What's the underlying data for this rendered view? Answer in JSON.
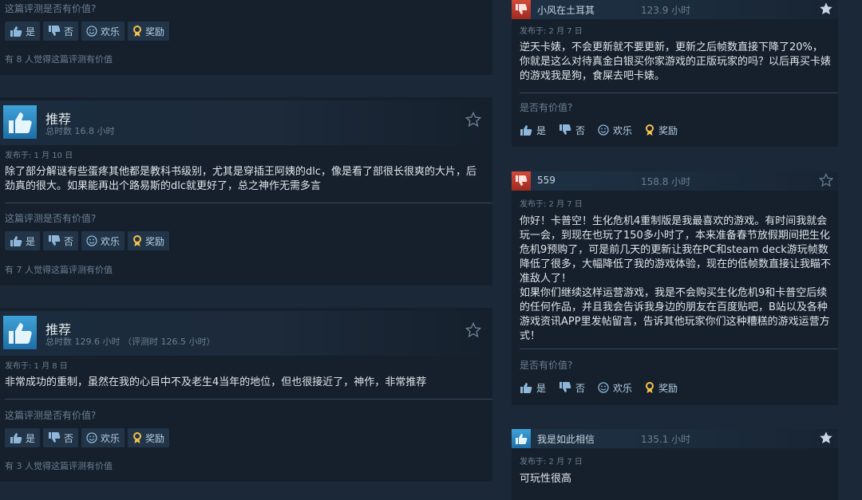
{
  "left_reviews": [
    {
      "partial": true,
      "helpful_question": "这篇评测是否有价值?",
      "found_helpful": "有 8 人觉得这篇评测有价值"
    },
    {
      "verdict": "推荐",
      "hours": "总时数 16.8 小时",
      "posted": "发布于: 1 月 10 日",
      "text": "除了部分解谜有些蛋疼其他都是教科书级别，尤其是穿插王阿姨的dlc，像是看了部很长很爽的大片，后劲真的很大。如果能再出个路易斯的dlc就更好了，总之神作无需多言",
      "helpful_question": "这篇评测是否有价值?",
      "found_helpful": "有 7 人觉得这篇评测有价值"
    },
    {
      "verdict": "推荐",
      "hours": "总时数 129.6 小时 （评测时 126.5 小时）",
      "posted": "发布于: 1 月 8 日",
      "text": "非常成功的重制，虽然在我的心目中不及老生4当年的地位，但也很接近了，神作，非常推荐",
      "helpful_question": "这篇评测是否有价值?",
      "found_helpful": "有 3 人觉得这篇评测有价值"
    }
  ],
  "vote_labels": {
    "yes": "是",
    "no": "否",
    "funny": "欢乐",
    "award": "奖励"
  },
  "right_reviews": [
    {
      "recommended": false,
      "name": "小风在土耳其",
      "hours": "123.9 小时",
      "posted": "发布于: 2 月 7 日",
      "text": "逆天卡婊，不会更新就不要更新，更新之后帧数直接下降了20%，你就是这么对待真金白银买你家游戏的正版玩家的吗？以后再买卡婊的游戏我是狗，食屎去吧卡婊。",
      "helpful_question": "是否有价值?"
    },
    {
      "recommended": false,
      "name": "559",
      "hours": "158.8 小时",
      "posted": "发布于: 2 月 7 日",
      "text": "你好！卡普空！生化危机4重制版是我最喜欢的游戏。有时间我就会玩一会，到现在也玩了150多小时了，本来准备春节放假期间把生化危机9预购了，可是前几天的更新让我在PC和steam deck游玩帧数降低了很多，大幅降低了我的游戏体验，现在的低帧数直接让我瞄不准敌人了！",
      "text2": "如果你们继续这样运营游戏，我是不会购买生化危机9和卡普空后续的任何作品，并且我会告诉我身边的朋友在百度贴吧，B站以及各种游戏资讯APP里发帖留言，告诉其他玩家你们这种糟糕的游戏运营方式！",
      "helpful_question": "是否有价值?"
    },
    {
      "recommended": true,
      "name": "我是如此相信",
      "hours": "135.1 小时",
      "posted": "发布于: 2 月 7 日",
      "text": "可玩性很高"
    }
  ],
  "colors": {
    "accent": "#66c0f4",
    "thumb_up": "#3fa2d8",
    "thumb_down": "#d34a3a",
    "background": "#1b2838"
  }
}
